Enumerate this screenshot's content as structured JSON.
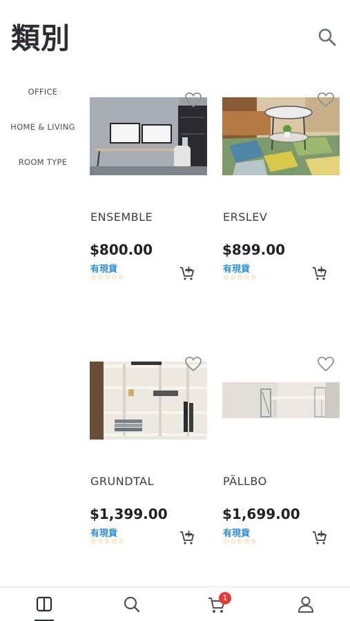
{
  "header": {
    "title": "類別"
  },
  "categories": [
    {
      "label": "OFFICE"
    },
    {
      "label": "HOME & LIVING"
    },
    {
      "label": "ROOM TYPE"
    }
  ],
  "products": [
    {
      "name": "ENSEMBLE",
      "price": "$800.00",
      "stock": "有現貨",
      "rating": "☆☆☆☆☆"
    },
    {
      "name": "ERSLEV",
      "price": "$899.00",
      "stock": "有現貨",
      "rating": "☆☆☆☆☆"
    },
    {
      "name": "GRUNDTAL",
      "price": "$1,399.00",
      "stock": "有現貨",
      "rating": "☆☆☆☆☆"
    },
    {
      "name": "PÄLLBO",
      "price": "$1,699.00",
      "stock": "有現貨",
      "rating": "☆☆☆☆☆"
    }
  ],
  "bottom_nav": {
    "items": [
      "categories-icon",
      "search-icon",
      "cart-icon",
      "profile-icon"
    ],
    "cart_badge": "1"
  },
  "colors": {
    "accent": "#2b8ed6",
    "stars": "#f0a020",
    "badge": "#e53935",
    "title": "#2b2f33"
  }
}
